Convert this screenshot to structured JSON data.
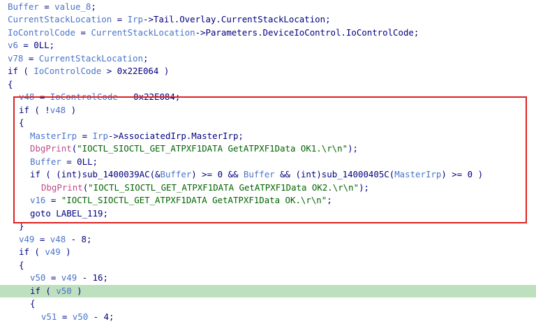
{
  "colors": {
    "variable": "#4a74c9",
    "keyword": "#000080",
    "api_call": "#c04a88",
    "string": "#006400",
    "highlight_line": "#bfe0bf",
    "annotation_box": "#e02020"
  },
  "code_lines": [
    {
      "indent": 0,
      "tokens": [
        {
          "t": "var",
          "v": "Buffer"
        },
        {
          "t": "op",
          "v": " = "
        },
        {
          "t": "var",
          "v": "value_8"
        },
        {
          "t": "op",
          "v": ";"
        }
      ]
    },
    {
      "indent": 0,
      "tokens": [
        {
          "t": "var",
          "v": "CurrentStackLocation"
        },
        {
          "t": "op",
          "v": " = "
        },
        {
          "t": "var",
          "v": "Irp"
        },
        {
          "t": "op",
          "v": "->Tail.Overlay.CurrentStackLocation;"
        }
      ]
    },
    {
      "indent": 0,
      "tokens": [
        {
          "t": "var",
          "v": "IoControlCode"
        },
        {
          "t": "op",
          "v": " = "
        },
        {
          "t": "var",
          "v": "CurrentStackLocation"
        },
        {
          "t": "op",
          "v": "->Parameters.DeviceIoControl.IoControlCode;"
        }
      ]
    },
    {
      "indent": 0,
      "tokens": [
        {
          "t": "var",
          "v": "v6"
        },
        {
          "t": "op",
          "v": " = 0LL;"
        }
      ]
    },
    {
      "indent": 0,
      "tokens": [
        {
          "t": "var",
          "v": "v78"
        },
        {
          "t": "op",
          "v": " = "
        },
        {
          "t": "var",
          "v": "CurrentStackLocation"
        },
        {
          "t": "op",
          "v": ";"
        }
      ]
    },
    {
      "indent": 0,
      "tokens": [
        {
          "t": "kw",
          "v": "if"
        },
        {
          "t": "op",
          "v": " ( "
        },
        {
          "t": "var",
          "v": "IoControlCode"
        },
        {
          "t": "op",
          "v": " > 0x22E064 )"
        }
      ]
    },
    {
      "indent": 0,
      "tokens": [
        {
          "t": "op",
          "v": "{"
        }
      ]
    },
    {
      "indent": 1,
      "tokens": [
        {
          "t": "var",
          "v": "v48"
        },
        {
          "t": "op",
          "v": " = "
        },
        {
          "t": "var",
          "v": "IoControlCode"
        },
        {
          "t": "op",
          "v": " - 0x22E084;"
        }
      ]
    },
    {
      "indent": 1,
      "tokens": [
        {
          "t": "kw",
          "v": "if"
        },
        {
          "t": "op",
          "v": " ( !"
        },
        {
          "t": "var",
          "v": "v48"
        },
        {
          "t": "op",
          "v": " )"
        }
      ]
    },
    {
      "indent": 1,
      "tokens": [
        {
          "t": "op",
          "v": "{"
        }
      ]
    },
    {
      "indent": 2,
      "tokens": [
        {
          "t": "var",
          "v": "MasterIrp"
        },
        {
          "t": "op",
          "v": " = "
        },
        {
          "t": "var",
          "v": "Irp"
        },
        {
          "t": "op",
          "v": "->AssociatedIrp.MasterIrp;"
        }
      ]
    },
    {
      "indent": 2,
      "tokens": [
        {
          "t": "api",
          "v": "DbgPrint"
        },
        {
          "t": "op",
          "v": "("
        },
        {
          "t": "str",
          "v": "\"IOCTL_SIOCTL_GET_ATPXF1DATA GetATPXF1Data OK1.\\r\\n\""
        },
        {
          "t": "op",
          "v": ");"
        }
      ]
    },
    {
      "indent": 2,
      "tokens": [
        {
          "t": "var",
          "v": "Buffer"
        },
        {
          "t": "op",
          "v": " = 0LL;"
        }
      ]
    },
    {
      "indent": 2,
      "tokens": [
        {
          "t": "kw",
          "v": "if"
        },
        {
          "t": "op",
          "v": " ( (int)sub_1400039AC(&"
        },
        {
          "t": "var",
          "v": "Buffer"
        },
        {
          "t": "op",
          "v": ") >= 0 && "
        },
        {
          "t": "var",
          "v": "Buffer"
        },
        {
          "t": "op",
          "v": " && (int)sub_14000405C("
        },
        {
          "t": "var",
          "v": "MasterIrp"
        },
        {
          "t": "op",
          "v": ") >= 0 )"
        }
      ]
    },
    {
      "indent": 3,
      "tokens": [
        {
          "t": "api",
          "v": "DbgPrint"
        },
        {
          "t": "op",
          "v": "("
        },
        {
          "t": "str",
          "v": "\"IOCTL_SIOCTL_GET_ATPXF1DATA GetATPXF1Data OK2.\\r\\n\""
        },
        {
          "t": "op",
          "v": ");"
        }
      ]
    },
    {
      "indent": 2,
      "tokens": [
        {
          "t": "var",
          "v": "v16"
        },
        {
          "t": "op",
          "v": " = "
        },
        {
          "t": "str",
          "v": "\"IOCTL_SIOCTL_GET_ATPXF1DATA GetATPXF1Data OK.\\r\\n\""
        },
        {
          "t": "op",
          "v": ";"
        }
      ]
    },
    {
      "indent": 2,
      "tokens": [
        {
          "t": "kw",
          "v": "goto"
        },
        {
          "t": "op",
          "v": " LABEL_119;"
        }
      ]
    },
    {
      "indent": 1,
      "tokens": [
        {
          "t": "op",
          "v": "}"
        }
      ]
    },
    {
      "indent": 1,
      "tokens": [
        {
          "t": "var",
          "v": "v49"
        },
        {
          "t": "op",
          "v": " = "
        },
        {
          "t": "var",
          "v": "v48"
        },
        {
          "t": "op",
          "v": " - 8;"
        }
      ]
    },
    {
      "indent": 1,
      "tokens": [
        {
          "t": "kw",
          "v": "if"
        },
        {
          "t": "op",
          "v": " ( "
        },
        {
          "t": "var",
          "v": "v49"
        },
        {
          "t": "op",
          "v": " )"
        }
      ]
    },
    {
      "indent": 1,
      "tokens": [
        {
          "t": "op",
          "v": "{"
        }
      ]
    },
    {
      "indent": 2,
      "tokens": [
        {
          "t": "var",
          "v": "v50"
        },
        {
          "t": "op",
          "v": " = "
        },
        {
          "t": "var",
          "v": "v49"
        },
        {
          "t": "op",
          "v": " - 16;"
        }
      ]
    },
    {
      "indent": 2,
      "highlight": true,
      "tokens": [
        {
          "t": "kw",
          "v": "if"
        },
        {
          "t": "op",
          "v": " ( "
        },
        {
          "t": "var",
          "v": "v50"
        },
        {
          "t": "op",
          "v": " )"
        }
      ]
    },
    {
      "indent": 2,
      "tokens": [
        {
          "t": "op",
          "v": "{"
        }
      ]
    },
    {
      "indent": 3,
      "tokens": [
        {
          "t": "var",
          "v": "v51"
        },
        {
          "t": "op",
          "v": " = "
        },
        {
          "t": "var",
          "v": "v50"
        },
        {
          "t": "op",
          "v": " - 4;"
        }
      ]
    }
  ]
}
